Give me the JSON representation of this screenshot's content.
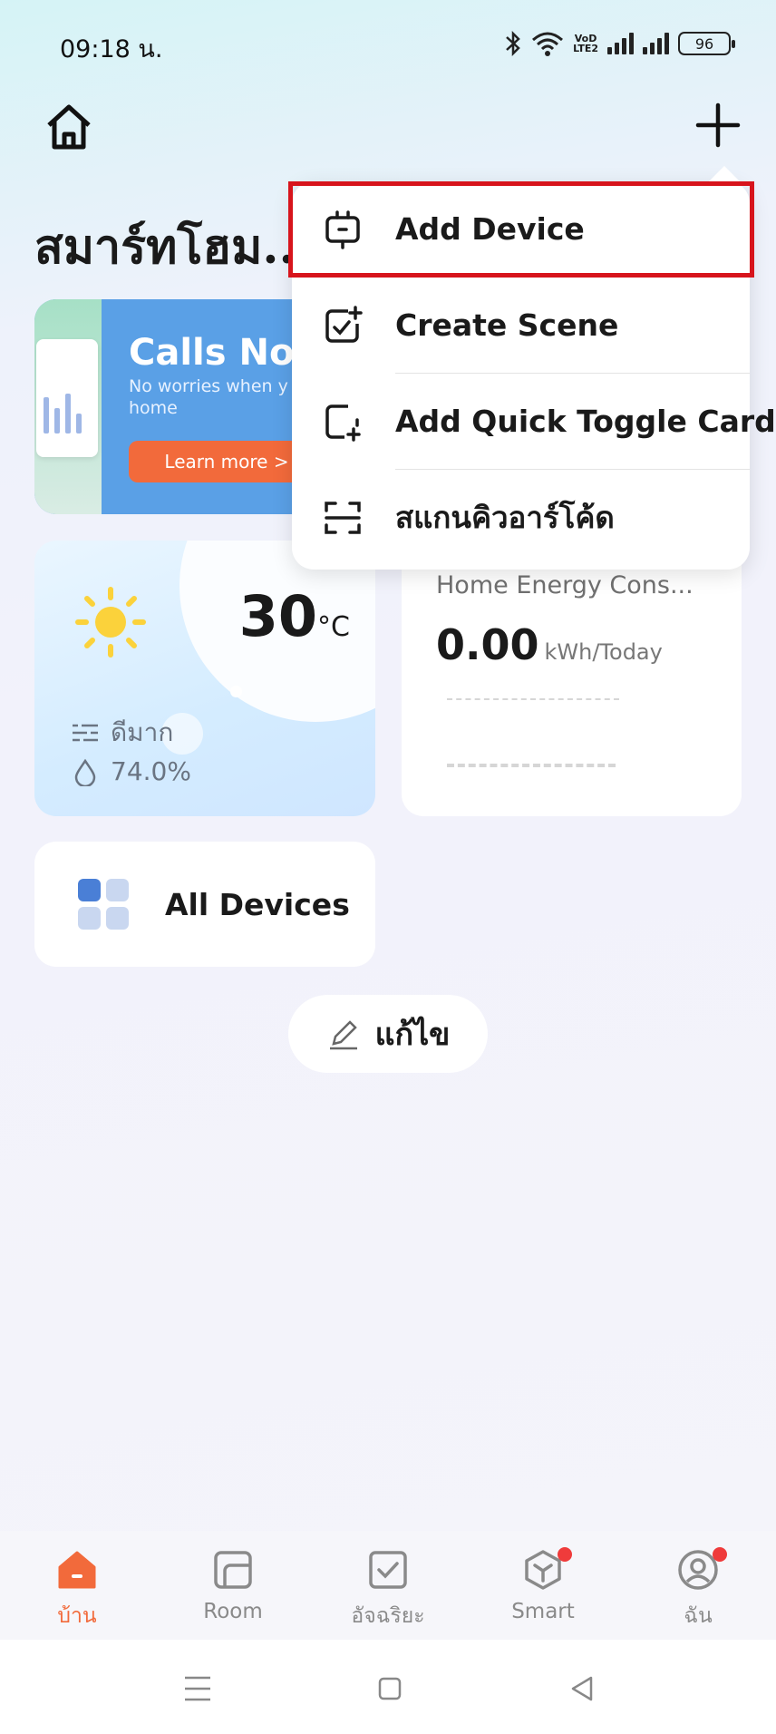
{
  "status_bar": {
    "time": "09:18 น.",
    "volte_top": "VoD",
    "volte_bottom": "LTE2",
    "battery": "96"
  },
  "header": {
    "title": "สมาร์ทโฮม..."
  },
  "banner": {
    "headline": "Calls No",
    "subtext": "No worries when y from home",
    "button_label": "Learn more >"
  },
  "weather": {
    "temperature": "30",
    "unit": "°C",
    "condition": "ดีมาก",
    "humidity": "74.0%"
  },
  "energy": {
    "title": "Home Energy Cons...",
    "value": "0.00",
    "unit": "kWh/Today"
  },
  "all_devices": {
    "label": "All Devices"
  },
  "edit": {
    "label": "แก้ไข"
  },
  "menu": {
    "items": [
      {
        "label": "Add Device",
        "icon": "add-device-icon"
      },
      {
        "label": "Create Scene",
        "icon": "create-scene-icon"
      },
      {
        "label": "Add Quick Toggle Card",
        "icon": "quick-toggle-icon"
      },
      {
        "label": "สแกนคิวอาร์โค้ด",
        "icon": "scan-qr-icon"
      }
    ],
    "highlight_color": "#d7141c"
  },
  "bottom_nav": {
    "items": [
      {
        "label": "บ้าน",
        "icon": "home-icon",
        "active": true
      },
      {
        "label": "Room",
        "icon": "room-icon"
      },
      {
        "label": "อัจฉริยะ",
        "icon": "smart-check-icon"
      },
      {
        "label": "Smart",
        "icon": "smart-cube-icon",
        "badge": true
      },
      {
        "label": "ฉัน",
        "icon": "profile-icon",
        "badge": true
      }
    ],
    "active_color": "#f26a3b"
  }
}
